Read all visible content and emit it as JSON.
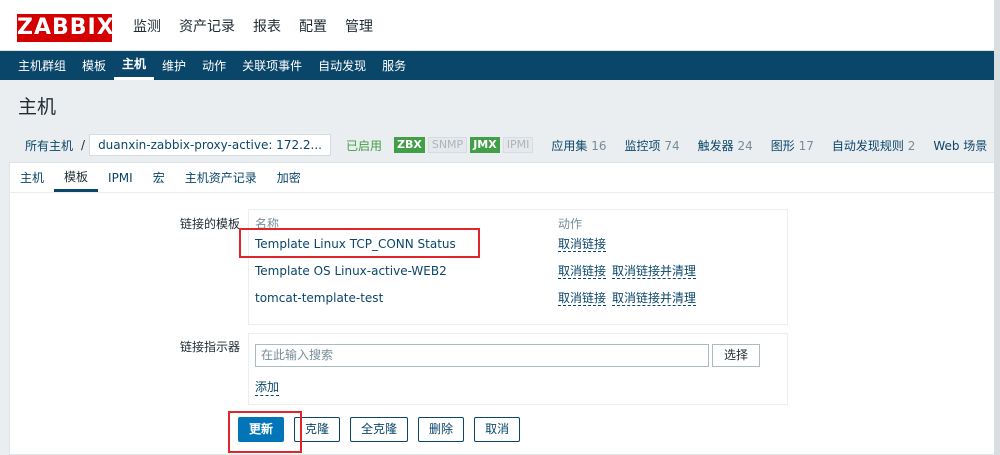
{
  "topbar": {
    "logo": "ZABBIX",
    "menu": [
      "监测",
      "资产记录",
      "报表",
      "配置",
      "管理"
    ],
    "selected": "配置"
  },
  "subnav": {
    "items": [
      "主机群组",
      "模板",
      "主机",
      "维护",
      "动作",
      "关联项事件",
      "自动发现",
      "服务"
    ],
    "selected": "主机"
  },
  "page": {
    "title": "主机"
  },
  "breadcrumb": {
    "all_hosts": "所有主机",
    "host": "duanxin-zabbix-proxy-active: 172.2...",
    "enabled": "已启用",
    "tags": [
      {
        "label": "ZBX",
        "state": "on"
      },
      {
        "label": "SNMP",
        "state": "off"
      },
      {
        "label": "JMX",
        "state": "on"
      },
      {
        "label": "IPMI",
        "state": "off"
      }
    ],
    "links": [
      {
        "label": "应用集",
        "count": "16"
      },
      {
        "label": "监控项",
        "count": "74"
      },
      {
        "label": "触发器",
        "count": "24"
      },
      {
        "label": "图形",
        "count": "17"
      },
      {
        "label": "自动发现规则",
        "count": "2"
      },
      {
        "label": "Web 场景",
        "count": ""
      }
    ]
  },
  "tabs": [
    "主机",
    "模板",
    "IPMI",
    "宏",
    "主机资产记录",
    "加密"
  ],
  "selected_tab": "模板",
  "linked_templates": {
    "label": "链接的模板",
    "col_name": "名称",
    "col_action": "动作",
    "rows": [
      {
        "name": "Template Linux TCP_CONN Status",
        "unlink": "取消链接",
        "unlink_clear": ""
      },
      {
        "name": "Template OS Linux-active-WEB2",
        "unlink": "取消链接",
        "unlink_clear": "取消链接并清理"
      },
      {
        "name": "tomcat-template-test",
        "unlink": "取消链接",
        "unlink_clear": "取消链接并清理"
      }
    ]
  },
  "link_indicator": {
    "label": "链接指示器",
    "placeholder": "在此输入搜索",
    "select": "选择",
    "add": "添加"
  },
  "buttons": {
    "update": "更新",
    "clone": "克隆",
    "full_clone": "全克隆",
    "delete": "删除",
    "cancel": "取消"
  },
  "colors": {
    "brand": "#d40000",
    "nav": "#0a466a",
    "primary": "#0275b8",
    "enabled": "#429e47",
    "highlight": "#e0262a"
  }
}
